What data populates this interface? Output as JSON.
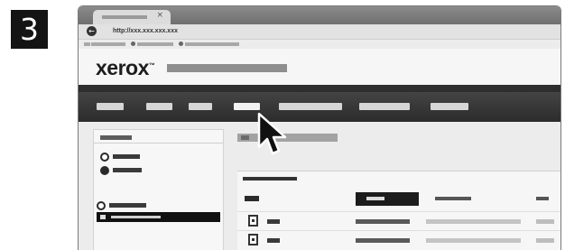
{
  "step_number": "3",
  "browser": {
    "tab": {
      "title": "",
      "close_glyph": "×"
    },
    "back_glyph": "←",
    "url": "http://xxx.xxx.xxx.xxx"
  },
  "logo": "xerox",
  "logo_mark": "™",
  "icons": {
    "close": "close-icon",
    "back": "back-arrow-icon",
    "printer": "printer-icon",
    "cursor": "mouse-pointer-icon"
  },
  "colors": {
    "badge": "#141414",
    "navbar": "#333333",
    "selected": "#111111"
  }
}
